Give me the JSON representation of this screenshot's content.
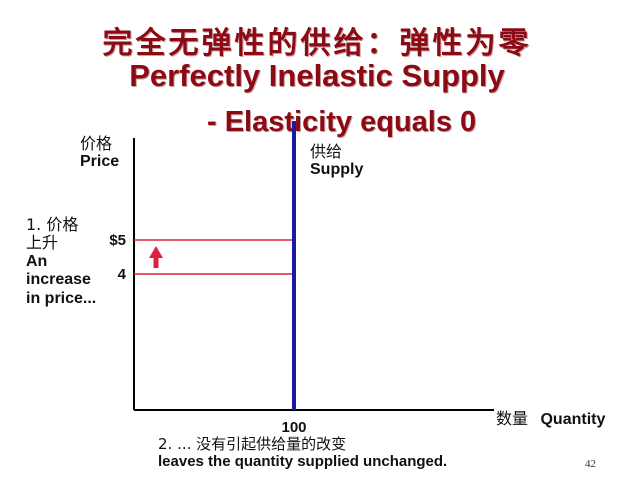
{
  "slide": {
    "title_cn": "完全无弹性的供给：弹性为零",
    "title_en": "Perfectly Inelastic Supply",
    "subtitle_en": "- Elasticity equals 0",
    "page_number": "42"
  },
  "labels": {
    "y_cn": "价格",
    "y_en": "Price",
    "supply_cn": "供给",
    "supply_en": "Supply",
    "increase_cn_1": "1. 价格",
    "increase_cn_2": "上升",
    "increase_en_1": "An",
    "increase_en_2": "increase",
    "increase_en_3": "in price...",
    "x_cn": "数量",
    "x_en": "Quantity",
    "note2_cn": "2. ... 没有引起供给量的改变",
    "note2_en": "leaves the quantity supplied unchanged."
  },
  "colors": {
    "title": "#8b0a14",
    "supply_line": "#1a1aa0",
    "price_lines": "#e0203a",
    "arrow": "#e0203a",
    "axes": "#000000"
  },
  "chart_data": {
    "type": "line",
    "title": "",
    "xlabel": "Quantity",
    "ylabel": "Price",
    "xlim": [
      0,
      200
    ],
    "ylim": [
      0,
      8
    ],
    "x_ticks": [
      {
        "value": 100,
        "label": "100"
      }
    ],
    "y_ticks": [
      {
        "value": 4,
        "label": "4"
      },
      {
        "value": 5,
        "label": "$5"
      }
    ],
    "series": [
      {
        "name": "Supply",
        "x": [
          100,
          100
        ],
        "y": [
          0,
          8.5
        ]
      }
    ],
    "price_levels": [
      4,
      5
    ],
    "arrow": {
      "from": 4,
      "to": 5,
      "direction": "up"
    },
    "grid": false,
    "legend": "none"
  }
}
